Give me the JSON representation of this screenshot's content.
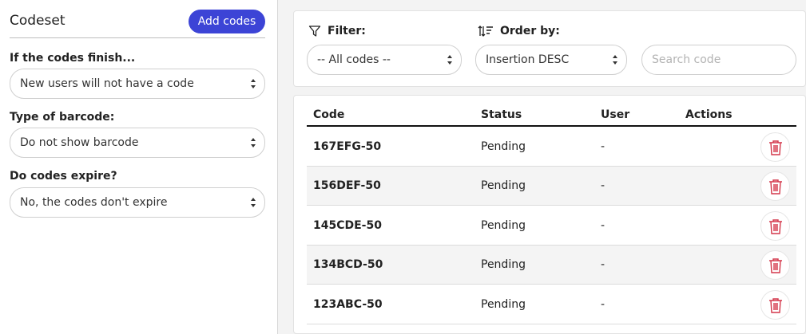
{
  "sidebar": {
    "title": "Codeset",
    "add_button": "Add codes",
    "fields": [
      {
        "label": "If the codes finish...",
        "value": "New users will not have a code"
      },
      {
        "label": "Type of barcode:",
        "value": "Do not show barcode"
      },
      {
        "label": "Do codes expire?",
        "value": "No, the codes don't expire"
      }
    ]
  },
  "filters": {
    "filter_label": "Filter:",
    "filter_value": "-- All codes --",
    "order_label": "Order by:",
    "order_value": "Insertion DESC",
    "search_placeholder": "Search code"
  },
  "table": {
    "headers": [
      "Code",
      "Status",
      "User",
      "Actions"
    ],
    "rows": [
      {
        "code": "167EFG-50",
        "status": "Pending",
        "user": "-"
      },
      {
        "code": "156DEF-50",
        "status": "Pending",
        "user": "-"
      },
      {
        "code": "145CDE-50",
        "status": "Pending",
        "user": "-"
      },
      {
        "code": "134BCD-50",
        "status": "Pending",
        "user": "-"
      },
      {
        "code": "123ABC-50",
        "status": "Pending",
        "user": "-"
      }
    ]
  },
  "colors": {
    "accent": "#3c44d6",
    "delete_icon": "#d4374a"
  },
  "icons": {
    "filter": "funnel-icon",
    "order": "sort-icon",
    "delete": "trash-icon"
  }
}
